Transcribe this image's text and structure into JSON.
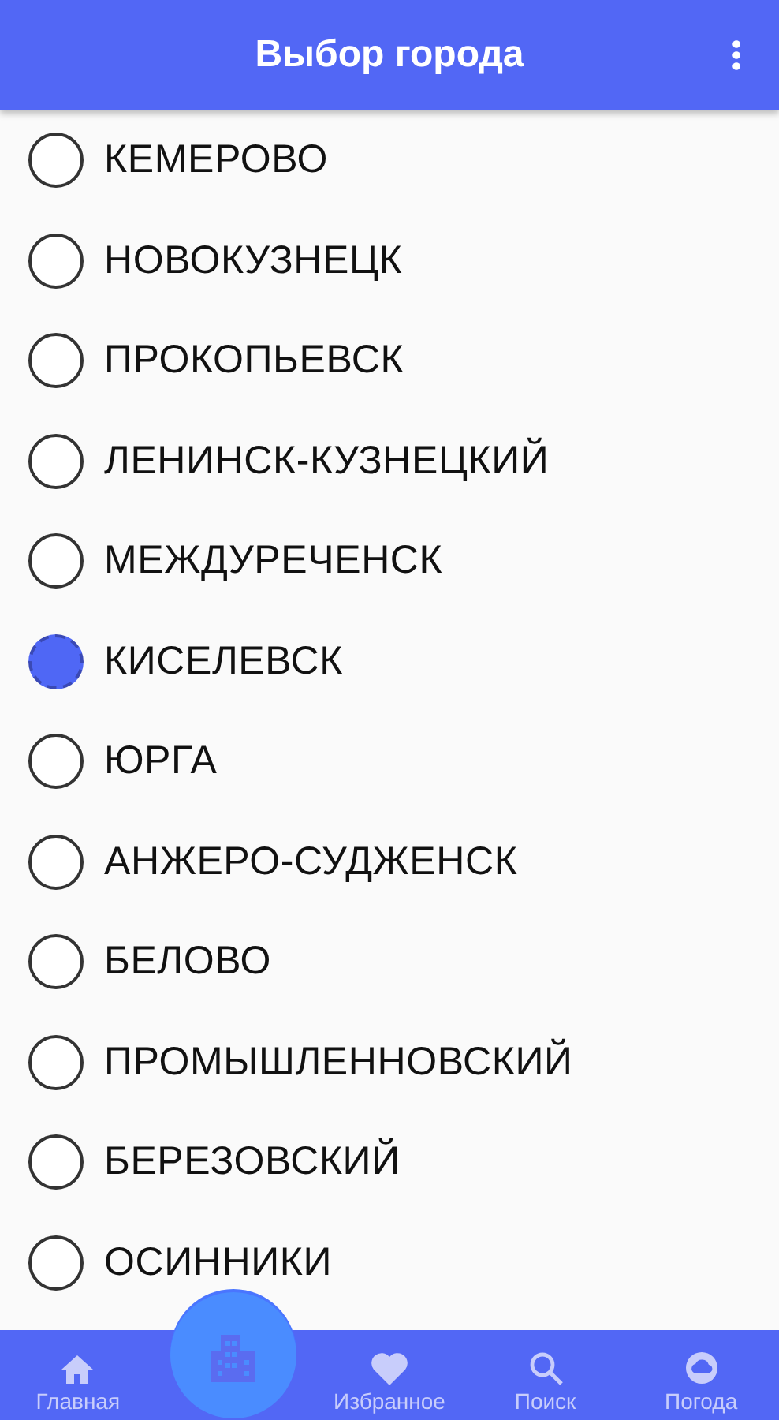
{
  "app_bar": {
    "title": "Выбор города"
  },
  "cities": [
    {
      "name": "КЕМЕРОВО",
      "selected": false
    },
    {
      "name": "НОВОКУЗНЕЦК",
      "selected": false
    },
    {
      "name": "ПРОКОПЬЕВСК",
      "selected": false
    },
    {
      "name": "ЛЕНИНСК-КУЗНЕЦКИЙ",
      "selected": false
    },
    {
      "name": "МЕЖДУРЕЧЕНСК",
      "selected": false
    },
    {
      "name": "КИСЕЛЕВСК",
      "selected": true
    },
    {
      "name": "ЮРГА",
      "selected": false
    },
    {
      "name": "АНЖЕРО-СУДЖЕНСК",
      "selected": false
    },
    {
      "name": "БЕЛОВО",
      "selected": false
    },
    {
      "name": "ПРОМЫШЛЕННОВСКИЙ",
      "selected": false
    },
    {
      "name": "БЕРЕЗОВСКИЙ",
      "selected": false
    },
    {
      "name": "ОСИННИКИ",
      "selected": false
    }
  ],
  "bottom_nav": [
    {
      "kind": "home",
      "label": "Главная"
    },
    {
      "kind": "city"
    },
    {
      "kind": "favorites",
      "label": "Избранное"
    },
    {
      "kind": "search",
      "label": "Поиск"
    },
    {
      "kind": "weather",
      "label": "Погода"
    }
  ]
}
